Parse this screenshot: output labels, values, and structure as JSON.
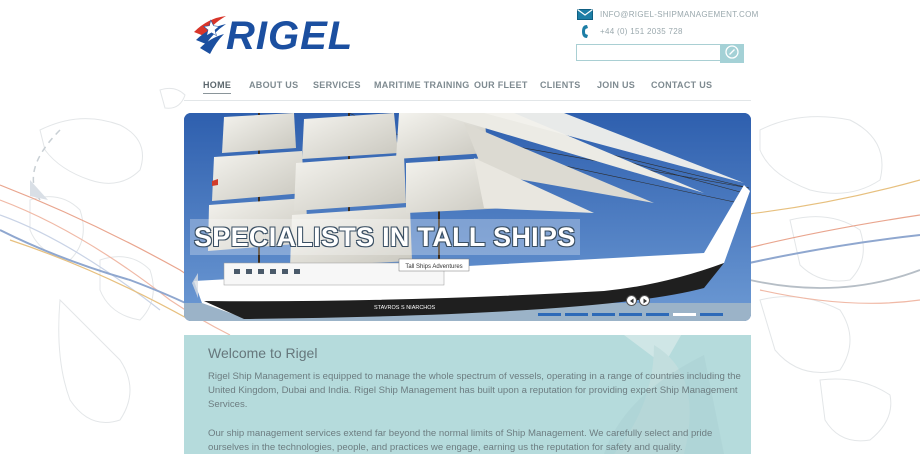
{
  "logo": {
    "text": "RIGEL"
  },
  "contact": {
    "email": "INFO@RIGEL-SHIPMANAGEMENT.COM",
    "phone": "+44 (0) 151 2035 728",
    "email_icon": "envelope-icon",
    "phone_icon": "phone-icon"
  },
  "search": {
    "placeholder": "",
    "button_icon": "search-icon"
  },
  "nav": {
    "items": [
      {
        "label": "HOME"
      },
      {
        "label": "ABOUT US"
      },
      {
        "label": "SERVICES"
      },
      {
        "label": "MARITIME TRAINING"
      },
      {
        "label": "OUR FLEET"
      },
      {
        "label": "CLIENTS"
      },
      {
        "label": "JOIN US"
      },
      {
        "label": "CONTACT US"
      }
    ],
    "active": "HOME"
  },
  "hero": {
    "caption": "SPECIALISTS IN TALL SHIPS",
    "banner_text": "Tall Ships Adventures",
    "hull_name": "STAVROS S NIARCHOS",
    "slides_total": 6,
    "active_slide": 5
  },
  "welcome": {
    "title": "Welcome to Rigel",
    "paragraph1": "Rigel Ship Management is equipped to manage the whole spectrum of vessels, operating in a range of countries including the United Kingdom, Dubai and India. Rigel Ship Management has built upon a reputation for providing expert Ship Management Services.",
    "paragraph2": "Our ship management services extend far beyond the normal limits of Ship Management. We carefully select and pride ourselves in the technologies, people, and practices we engage, earning us the reputation for safety and quality."
  },
  "colors": {
    "brand_blue": "#1b4fa0",
    "brand_red": "#d8352a",
    "welcome_bg": "#b5dbdc",
    "search_button": "#a4d1d6",
    "nav_text": "#7e8a90"
  }
}
